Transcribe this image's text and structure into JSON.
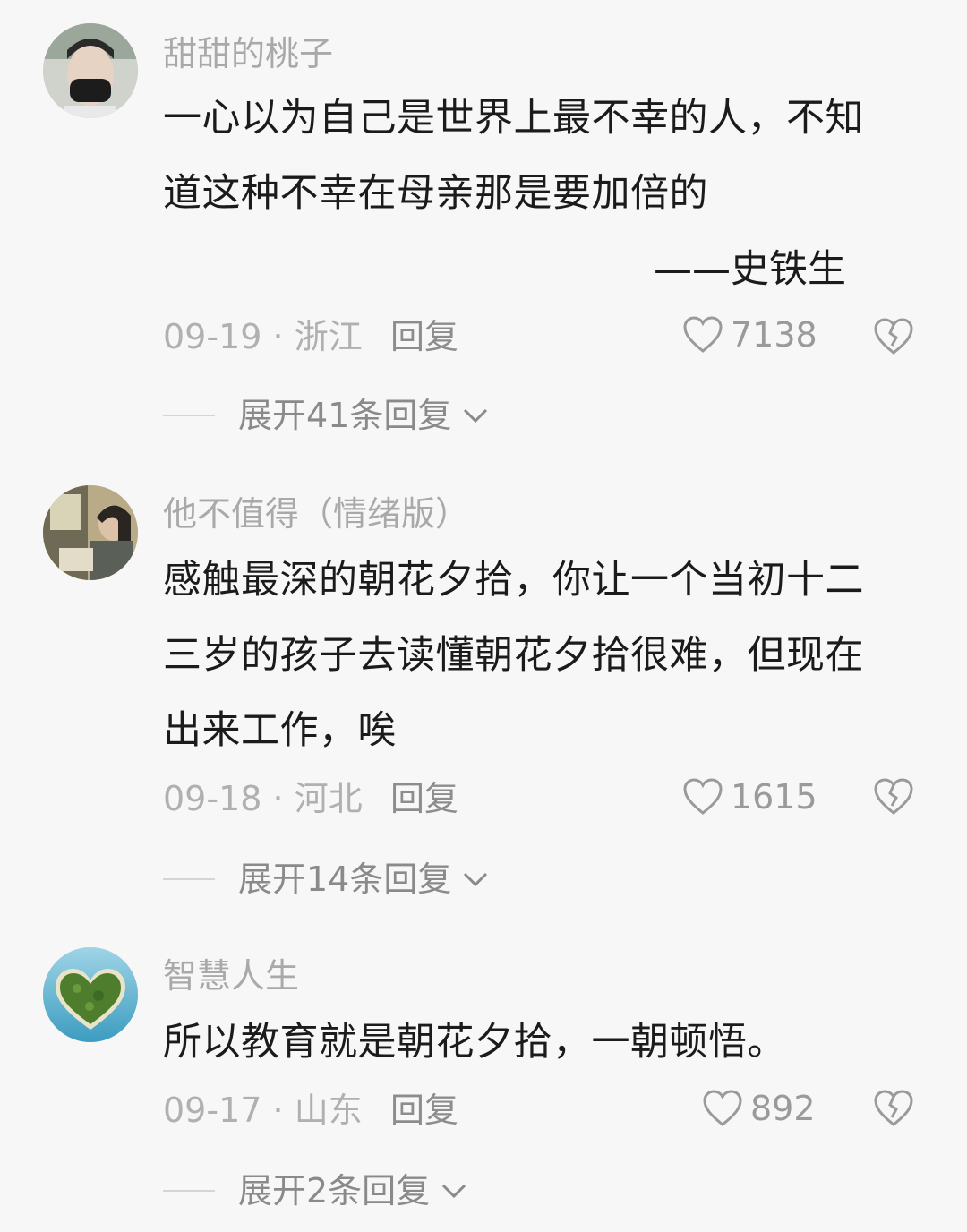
{
  "comments": [
    {
      "username": "甜甜的桃子",
      "text": "一心以为自己是世界上最不幸的人，不知道这种不幸在母亲那是要加倍的",
      "signature": "——史铁生",
      "date": "09-19",
      "location": "浙江",
      "reply_label": "回复",
      "likes": "7138",
      "expand_label": "展开41条回复"
    },
    {
      "username": "他不值得（情绪版）",
      "text": "感触最深的朝花夕拾，你让一个当初十二三岁的孩子去读懂朝花夕拾很难，但现在出来工作，唉",
      "date": "09-18",
      "location": "河北",
      "reply_label": "回复",
      "likes": "1615",
      "expand_label": "展开14条回复"
    },
    {
      "username": "智慧人生",
      "text": "所以教育就是朝花夕拾，一朝顿悟。",
      "date": "09-17",
      "location": "山东",
      "reply_label": "回复",
      "likes": "892",
      "expand_label": "展开2条回复"
    }
  ],
  "icons": {
    "like": "heart-outline-icon",
    "dislike": "broken-heart-icon",
    "expand": "chevron-down-icon"
  },
  "colors": {
    "background": "#f7f7f7",
    "username": "#a9a9a9",
    "body_text": "#1b1b1b",
    "meta": "#b0b0b0"
  }
}
